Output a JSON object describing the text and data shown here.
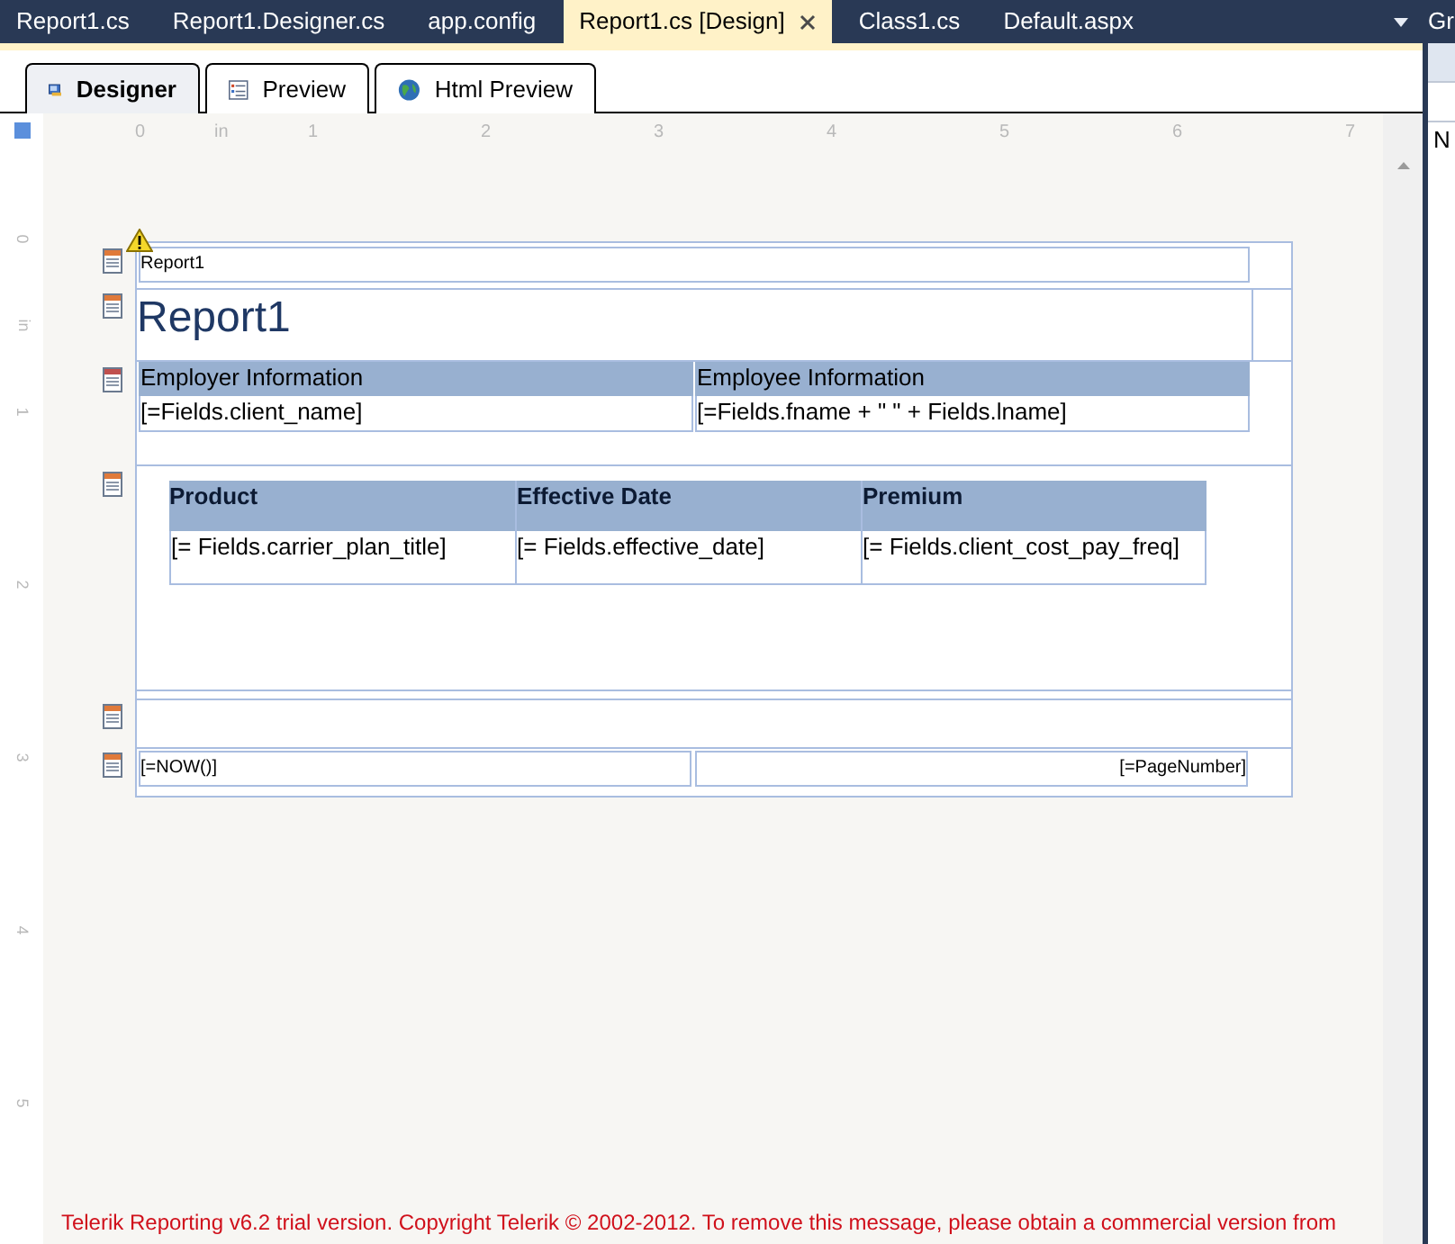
{
  "document_tabs": [
    {
      "label": "Report1.cs",
      "selected": false
    },
    {
      "label": "Report1.Designer.cs",
      "selected": false
    },
    {
      "label": "app.config",
      "selected": false
    },
    {
      "label": "Report1.cs [Design]",
      "selected": true
    },
    {
      "label": "Class1.cs",
      "selected": false
    },
    {
      "label": "Default.aspx",
      "selected": false
    }
  ],
  "designer_tabs": [
    {
      "label": "Designer",
      "kind": "designer",
      "selected": true
    },
    {
      "label": "Preview",
      "kind": "preview",
      "selected": false
    },
    {
      "label": "Html Preview",
      "kind": "html",
      "selected": false
    }
  ],
  "horizontal_ruler": [
    "0",
    "in",
    "1",
    "2",
    "3",
    "4",
    "5",
    "6",
    "7"
  ],
  "vertical_ruler": [
    "0",
    "in",
    "1",
    "2",
    "3",
    "4",
    "5"
  ],
  "report": {
    "page_header": {
      "text": "Report1",
      "warning": true
    },
    "report_header": {
      "title": "Report1"
    },
    "group_header": {
      "columns": [
        {
          "heading": "Employer Information",
          "field": "[=Fields.client_name]"
        },
        {
          "heading": "Employee Information",
          "field": "[=Fields.fname + \" \" + Fields.lname]"
        }
      ]
    },
    "detail_table": {
      "columns": [
        {
          "heading": "Product",
          "field": "[= Fields.carrier_plan_title]"
        },
        {
          "heading": "Effective Date",
          "field": "[= Fields.effective_date]"
        },
        {
          "heading": "Premium",
          "field": "[= Fields.client_cost_pay_freq]"
        }
      ]
    },
    "page_footer": {
      "left": "[=NOW()]",
      "right": "[=PageNumber]"
    }
  },
  "trial_notice": "Telerik Reporting v6.2 trial version. Copyright Telerik © 2002-2012. To remove this message, please obtain a commercial version from",
  "side_panel": {
    "title": "Gr",
    "item": "N"
  }
}
